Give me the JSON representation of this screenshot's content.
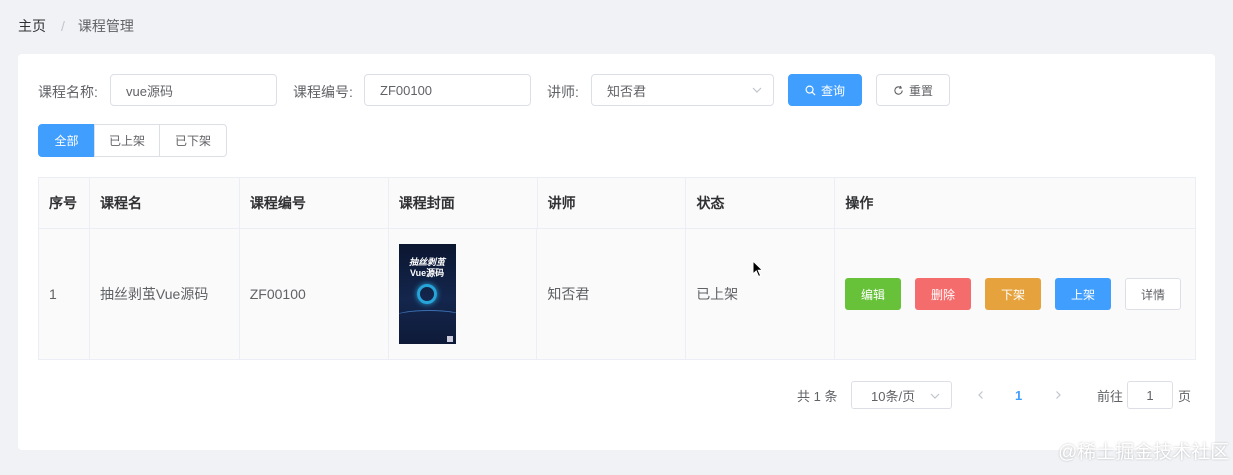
{
  "breadcrumb": {
    "home": "主页",
    "separator": "/",
    "current": "课程管理"
  },
  "search": {
    "name_label": "课程名称:",
    "name_value": "vue源码",
    "code_label": "课程编号:",
    "code_value": "ZF00100",
    "teacher_label": "讲师:",
    "teacher_value": "知否君",
    "query_label": "查询",
    "reset_label": "重置"
  },
  "filters": {
    "all": "全部",
    "on": "已上架",
    "off": "已下架",
    "active": "全部"
  },
  "table": {
    "headers": [
      "序号",
      "课程名",
      "课程编号",
      "课程封面",
      "讲师",
      "状态",
      "操作"
    ],
    "rows": [
      {
        "index": "1",
        "name": "抽丝剥茧Vue源码",
        "code": "ZF00100",
        "cover": {
          "line1": "抽丝剥茧",
          "line2": "Vue源码"
        },
        "teacher": "知否君",
        "status": "已上架"
      }
    ],
    "actions": {
      "edit": "编辑",
      "delete": "删除",
      "take_down": "下架",
      "put_up": "上架",
      "detail": "详情"
    }
  },
  "pagination": {
    "total_text": "共 1 条",
    "page_size": "10条/页",
    "current_page": "1",
    "goto_label": "前往",
    "goto_value": "1",
    "page_suffix": "页"
  },
  "watermark": "@稀土掘金技术社区",
  "colors": {
    "primary": "#409eff",
    "success": "#67c23a",
    "danger": "#f56c6c",
    "warning": "#e6a23c"
  }
}
